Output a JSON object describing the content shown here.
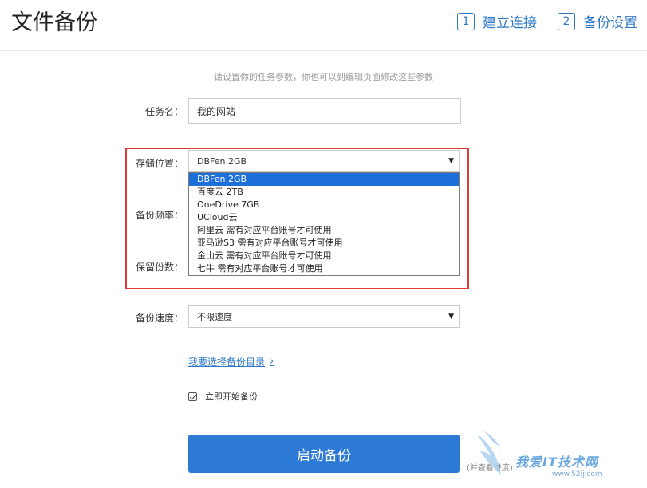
{
  "header": {
    "title": "文件备份",
    "steps": [
      {
        "num": "1",
        "label": "建立连接"
      },
      {
        "num": "2",
        "label": "备份设置"
      }
    ]
  },
  "hint": "请设置你的任务参数，你也可以到编辑页面修改这些参数",
  "form": {
    "task_name_label": "任务名：",
    "task_name_value": "我的网站",
    "storage_label": "存储位置：",
    "storage_selected": "DBFen 2GB",
    "storage_options": [
      "DBFen 2GB",
      "百度云 2TB",
      "OneDrive 7GB",
      "UCloud云",
      "阿里云 需有对应平台账号才可使用",
      "亚马逊S3 需有对应平台账号才可使用",
      "金山云 需有对应平台账号才可使用",
      "七牛 需有对应平台账号才可使用"
    ],
    "frequency_label": "备份频率：",
    "retain_label": "保留份数：",
    "speed_label": "备份速度：",
    "speed_selected": "不限速度",
    "dir_link": "我要选择备份目录",
    "start_now_label": "立即开始备份",
    "start_now_checked": true,
    "start_button": "启动备份",
    "side_note": "(并查看进度)"
  },
  "watermark": {
    "title": "我爱IT技术网",
    "sub": "www.52ij.com"
  },
  "colors": {
    "accent": "#2f79c7",
    "button": "#2d7ad6",
    "highlight": "#e53935",
    "selected_option": "#1e6fd9"
  }
}
